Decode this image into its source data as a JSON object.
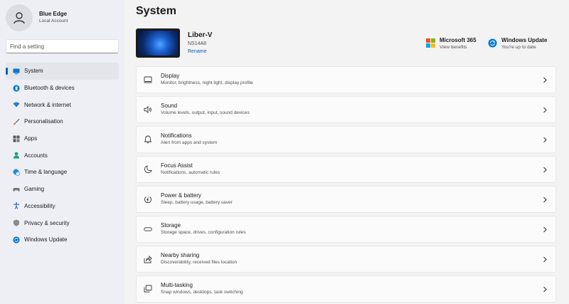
{
  "user": {
    "name": "Blue Edge",
    "account": "Local Account"
  },
  "search": {
    "placeholder": "Find a setting"
  },
  "nav": {
    "items": [
      {
        "label": "System",
        "icon": "monitor-icon"
      },
      {
        "label": "Bluetooth & devices",
        "icon": "bluetooth-icon"
      },
      {
        "label": "Network & internet",
        "icon": "wifi-icon"
      },
      {
        "label": "Personalisation",
        "icon": "brush-icon"
      },
      {
        "label": "Apps",
        "icon": "apps-icon"
      },
      {
        "label": "Accounts",
        "icon": "person-icon"
      },
      {
        "label": "Time & language",
        "icon": "globe-clock-icon"
      },
      {
        "label": "Gaming",
        "icon": "gamepad-icon"
      },
      {
        "label": "Accessibility",
        "icon": "accessibility-icon"
      },
      {
        "label": "Privacy & security",
        "icon": "shield-icon"
      },
      {
        "label": "Windows Update",
        "icon": "update-icon"
      }
    ]
  },
  "page": {
    "title": "System"
  },
  "device": {
    "name": "Liber-V",
    "model": "NS14A8",
    "rename_label": "Rename"
  },
  "widgets": {
    "m365": {
      "title": "Microsoft 365",
      "sub": "View benefits"
    },
    "update": {
      "title": "Windows Update",
      "sub": "You're up to date"
    }
  },
  "cards": [
    {
      "title": "Display",
      "sub": "Monitor, brightness, night light, display profile",
      "icon": "display-icon"
    },
    {
      "title": "Sound",
      "sub": "Volume levels, output, input, sound devices",
      "icon": "speaker-icon"
    },
    {
      "title": "Notifications",
      "sub": "Alert from apps and system",
      "icon": "bell-icon"
    },
    {
      "title": "Focus Assist",
      "sub": "Notifications, automatic rules",
      "icon": "moon-icon"
    },
    {
      "title": "Power & battery",
      "sub": "Sleep, battery usage, battery saver",
      "icon": "power-icon"
    },
    {
      "title": "Storage",
      "sub": "Storage space, drives, configuration rules",
      "icon": "storage-icon"
    },
    {
      "title": "Nearby sharing",
      "sub": "Discoverability, received files location",
      "icon": "share-icon"
    },
    {
      "title": "Multi-tasking",
      "sub": "Snap windows, desktops, task switching",
      "icon": "multitask-icon"
    }
  ],
  "colors": {
    "accent": "#005fb8",
    "ms_red": "#f25022",
    "ms_green": "#7fba00",
    "ms_blue": "#00a4ef",
    "ms_yellow": "#ffb900"
  }
}
